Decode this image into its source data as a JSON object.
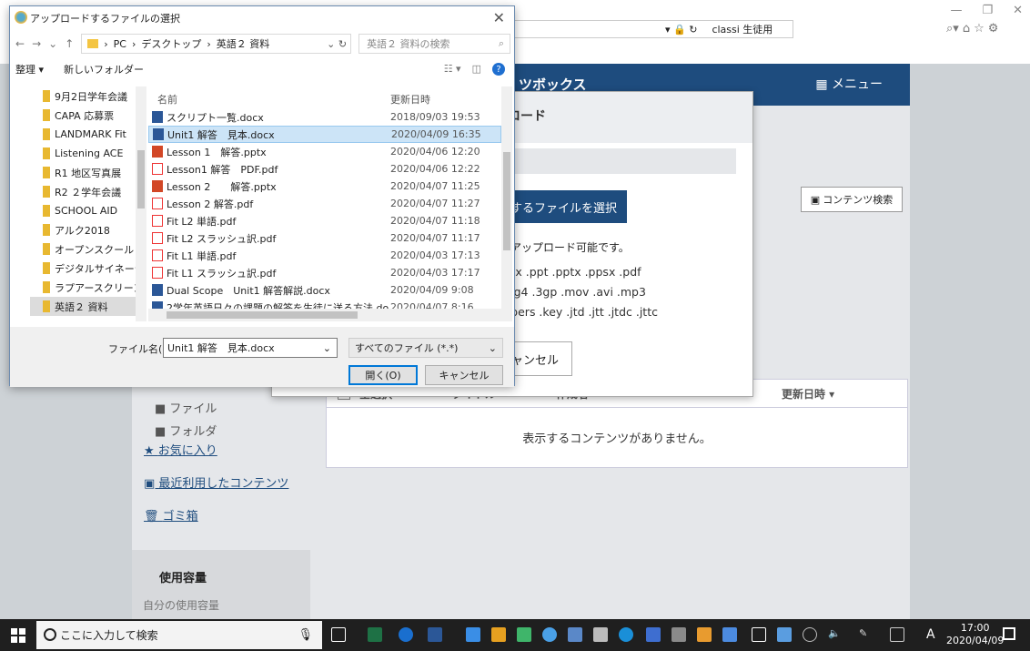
{
  "browser": {
    "window_controls": [
      "—",
      "❐",
      "✕"
    ],
    "address_title": "classi 生徒用",
    "tools": [
      "⌕▾",
      "⌂",
      "☆",
      "⚙"
    ]
  },
  "page": {
    "brand": "ツボックス",
    "menu_label": "メニュー",
    "side_links": [
      "お気に入り",
      "最近利用したコンテンツ",
      "ゴミ箱"
    ],
    "folder_tree": [
      "ファイル",
      "フォルダ"
    ],
    "usage_title": "使用容量",
    "usage_sub": "自分の使用容量",
    "list_headers": {
      "select_all": "全選択",
      "title": "タイトル",
      "author": "作成者",
      "updated": "更新日時 ▾"
    },
    "empty_message": "表示するコンテンツがありません。",
    "content_search": "コンテンツ検索"
  },
  "upload_modal": {
    "title": "プロード",
    "select_button": "するファイルを選択",
    "note": "をアップロード可能です。",
    "ext_lines": [
      "xlsx .ppt .pptx .ppsx .pdf",
      "peg4 .3gp .mov .avi .mp3",
      "mbers .key .jtd .jtt .jtdc .jttc"
    ],
    "cancel": "ャンセル"
  },
  "file_dialog": {
    "title": "アップロードするファイルの選択",
    "path": [
      "PC",
      "デスクトップ",
      "英語２ 資料"
    ],
    "search_placeholder": "英語２ 資料の検索",
    "organize": "整理 ▾",
    "new_folder": "新しいフォルダー",
    "nav_items": [
      {
        "label": "9月2日学年会議",
        "selected": false
      },
      {
        "label": "CAPA 応募票",
        "selected": false
      },
      {
        "label": "LANDMARK Fit",
        "selected": false
      },
      {
        "label": "Listening ACE",
        "selected": false
      },
      {
        "label": "R1 地区写真展",
        "selected": false
      },
      {
        "label": "R2 ２学年会議",
        "selected": false
      },
      {
        "label": "SCHOOL AID",
        "selected": false
      },
      {
        "label": "アルク2018",
        "selected": false
      },
      {
        "label": "オープンスクール",
        "selected": false
      },
      {
        "label": "デジタルサイネージ",
        "selected": false
      },
      {
        "label": "ラプアースクリーン",
        "selected": false
      },
      {
        "label": "英語２ 資料",
        "selected": true
      }
    ],
    "col_name": "名前",
    "col_date": "更新日時",
    "files": [
      {
        "name": "スクリプト一覧.docx",
        "date": "2018/09/03 19:53",
        "type": "docx",
        "selected": false
      },
      {
        "name": "Unit1 解答　見本.docx",
        "date": "2020/04/09 16:35",
        "type": "docx",
        "selected": true
      },
      {
        "name": "Lesson 1　解答.pptx",
        "date": "2020/04/06 12:20",
        "type": "pptx",
        "selected": false
      },
      {
        "name": "Lesson1 解答　PDF.pdf",
        "date": "2020/04/06 12:22",
        "type": "pdf",
        "selected": false
      },
      {
        "name": "Lesson 2　　解答.pptx",
        "date": "2020/04/07 11:25",
        "type": "pptx",
        "selected": false
      },
      {
        "name": "Lesson 2 解答.pdf",
        "date": "2020/04/07 11:27",
        "type": "pdf",
        "selected": false
      },
      {
        "name": "Fit L2 単語.pdf",
        "date": "2020/04/07 11:18",
        "type": "pdf",
        "selected": false
      },
      {
        "name": "Fit L2 スラッシュ訳.pdf",
        "date": "2020/04/07 11:17",
        "type": "pdf",
        "selected": false
      },
      {
        "name": "Fit L1 単語.pdf",
        "date": "2020/04/03 17:13",
        "type": "pdf",
        "selected": false
      },
      {
        "name": "Fit L1 スラッシュ訳.pdf",
        "date": "2020/04/03 17:17",
        "type": "pdf",
        "selected": false
      },
      {
        "name": "Dual Scope　Unit1 解答解説.docx",
        "date": "2020/04/09 9:08",
        "type": "docx",
        "selected": false
      },
      {
        "name": "2学年英語日々の課題の解答を生徒に送る方法.do",
        "date": "2020/04/07 8:16",
        "type": "docx",
        "selected": false
      }
    ],
    "filename_label": "ファイル名(N):",
    "filename_value": "Unit1 解答　見本.docx",
    "filetype": "すべてのファイル (*.*)",
    "open": "開く(O)",
    "cancel": "キャンセル"
  },
  "taskbar": {
    "search_placeholder": "ここに入力して検索",
    "ime": "A",
    "time": "17:00",
    "date": "2020/04/09"
  }
}
